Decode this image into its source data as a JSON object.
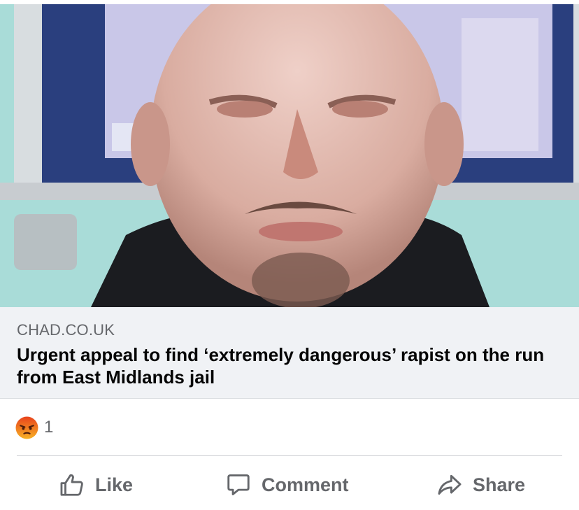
{
  "link_preview": {
    "domain": "CHAD.CO.UK",
    "headline": "Urgent appeal to find ‘extremely dangerous’ rapist on the run from East Midlands jail"
  },
  "reactions": {
    "icon": "angry-reaction-icon",
    "count": "1"
  },
  "actions": {
    "like_label": "Like",
    "comment_label": "Comment",
    "share_label": "Share"
  },
  "colors": {
    "secondary_text": "#65676b",
    "card_background": "#f0f2f5",
    "angry_reaction": "#f26a21"
  }
}
